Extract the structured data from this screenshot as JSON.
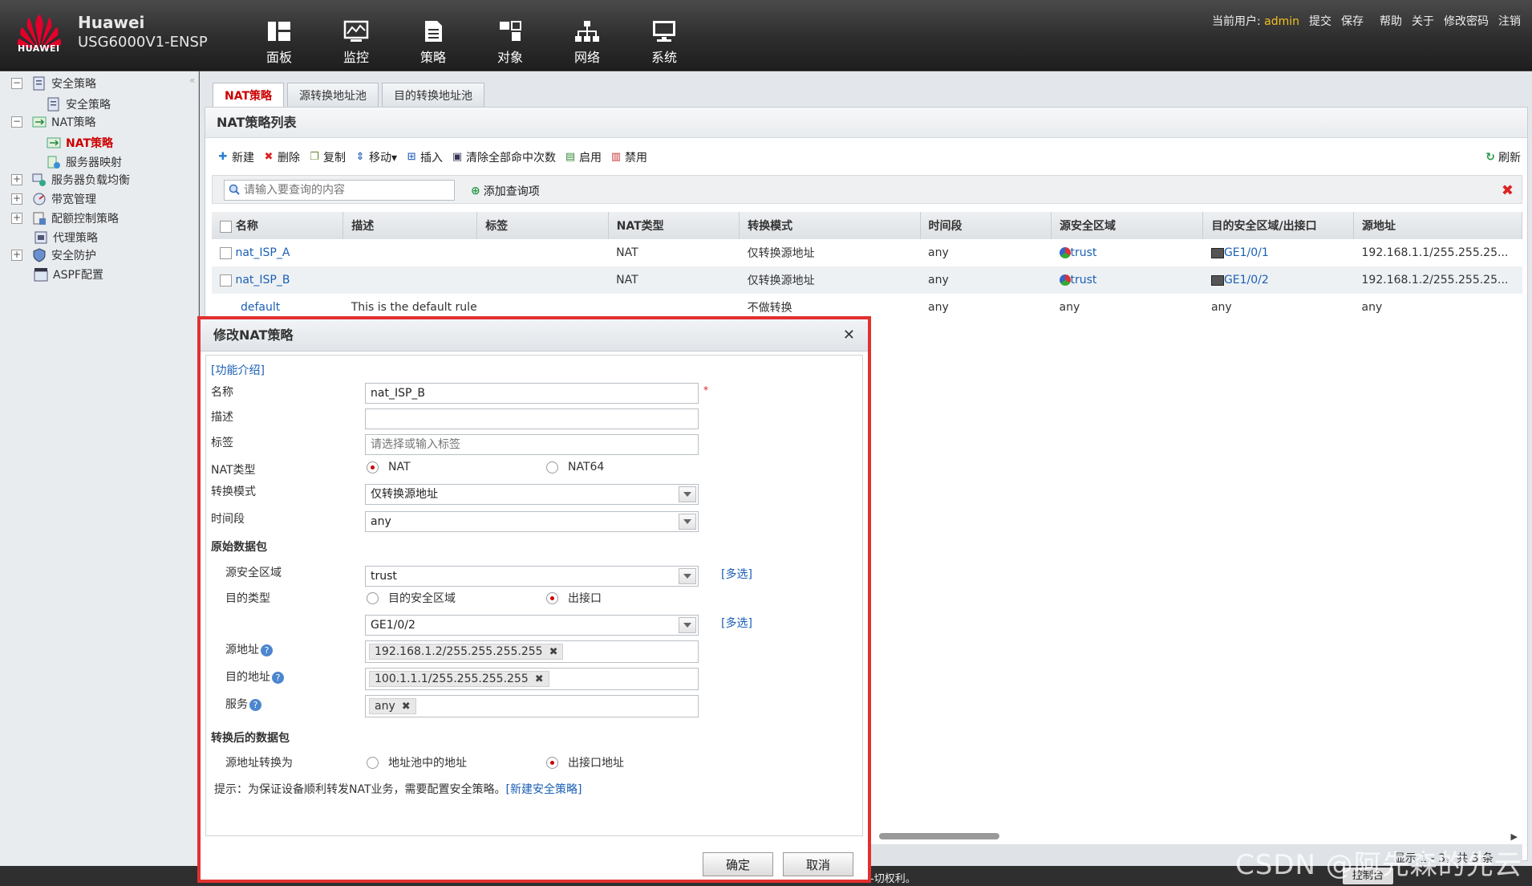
{
  "header": {
    "brand": "Huawei",
    "model": "USG6000V1-ENSP",
    "logo_text": "HUAWEI",
    "nav": [
      "面板",
      "监控",
      "策略",
      "对象",
      "网络",
      "系统"
    ],
    "current_user_label": "当前用户:",
    "current_user": "admin",
    "links": [
      "提交",
      "保存",
      "帮助",
      "关于",
      "修改密码",
      "注销"
    ]
  },
  "sidebar": {
    "items": [
      {
        "label": "安全策略",
        "level": 0,
        "expander": "−"
      },
      {
        "label": "安全策略",
        "level": 1
      },
      {
        "label": "NAT策略",
        "level": 0,
        "expander": "−"
      },
      {
        "label": "NAT策略",
        "level": 1,
        "selected": true
      },
      {
        "label": "服务器映射",
        "level": 1
      },
      {
        "label": "服务器负载均衡",
        "level": 0,
        "expander": "+"
      },
      {
        "label": "带宽管理",
        "level": 0,
        "expander": "+"
      },
      {
        "label": "配额控制策略",
        "level": 0,
        "expander": "+"
      },
      {
        "label": "代理策略",
        "level": 0
      },
      {
        "label": "安全防护",
        "level": 0,
        "expander": "+"
      },
      {
        "label": "ASPF配置",
        "level": 0
      }
    ]
  },
  "main": {
    "tabs": [
      "NAT策略",
      "源转换地址池",
      "目的转换地址池"
    ],
    "panel_title": "NAT策略列表",
    "toolbar": [
      "新建",
      "删除",
      "复制",
      "移动▾",
      "插入",
      "清除全部命中次数",
      "启用",
      "禁用"
    ],
    "refresh": "刷新",
    "search_placeholder": "请输入要查询的内容",
    "add_query": "添加查询项",
    "columns": [
      "名称",
      "描述",
      "标签",
      "NAT类型",
      "转换模式",
      "时间段",
      "源安全区域",
      "目的安全区域/出接口",
      "源地址"
    ],
    "rows": [
      {
        "name": "nat_ISP_A",
        "desc": "",
        "tag": "",
        "type": "NAT",
        "mode": "仅转换源地址",
        "time": "any",
        "src_zone": "trust",
        "dst": "GE1/0/1",
        "src_addr": "192.168.1.1/255.255.25..."
      },
      {
        "name": "nat_ISP_B",
        "desc": "",
        "tag": "",
        "type": "NAT",
        "mode": "仅转换源地址",
        "time": "any",
        "src_zone": "trust",
        "dst": "GE1/0/2",
        "src_addr": "192.168.1.2/255.255.25..."
      },
      {
        "name": "default",
        "desc": "This is the default rule",
        "tag": "",
        "type": "",
        "mode": "不做转换",
        "time": "any",
        "src_zone": "any",
        "dst": "any",
        "src_addr": "any"
      }
    ],
    "pager": "显示 1 - 3，共 3 条"
  },
  "footer": {
    "copyright": "-切权利。",
    "console": "控制台"
  },
  "watermark": "CSDN @阿先森的先云",
  "dialog": {
    "title": "修改NAT策略",
    "intro": "[功能介绍]",
    "name_label": "名称",
    "name_value": "nat_ISP_B",
    "required_mark": "*",
    "desc_label": "描述",
    "desc_value": "",
    "tag_label": "标签",
    "tag_placeholder": "请选择或输入标签",
    "nat_type_label": "NAT类型",
    "nat_type_opt1": "NAT",
    "nat_type_opt2": "NAT64",
    "mode_label": "转换模式",
    "mode_value": "仅转换源地址",
    "time_label": "时间段",
    "time_value": "any",
    "orig_section": "原始数据包",
    "src_zone_label": "源安全区域",
    "src_zone_value": "trust",
    "multi_select": "[多选]",
    "dst_type_label": "目的类型",
    "dst_type_opt1": "目的安全区域",
    "dst_type_opt2": "出接口",
    "out_if_value": "GE1/0/2",
    "src_addr_label": "源地址",
    "src_addr_chip": "192.168.1.2/255.255.255.255",
    "dst_addr_label": "目的地址",
    "dst_addr_chip": "100.1.1.1/255.255.255.255",
    "service_label": "服务",
    "service_chip": "any",
    "trans_section": "转换后的数据包",
    "src_trans_label": "源地址转换为",
    "src_trans_opt1": "地址池中的地址",
    "src_trans_opt2": "出接口地址",
    "hint": "提示：为保证设备顺利转发NAT业务，需要配置安全策略。",
    "hint_link": "[新建安全策略]",
    "ok": "确定",
    "cancel": "取消"
  }
}
